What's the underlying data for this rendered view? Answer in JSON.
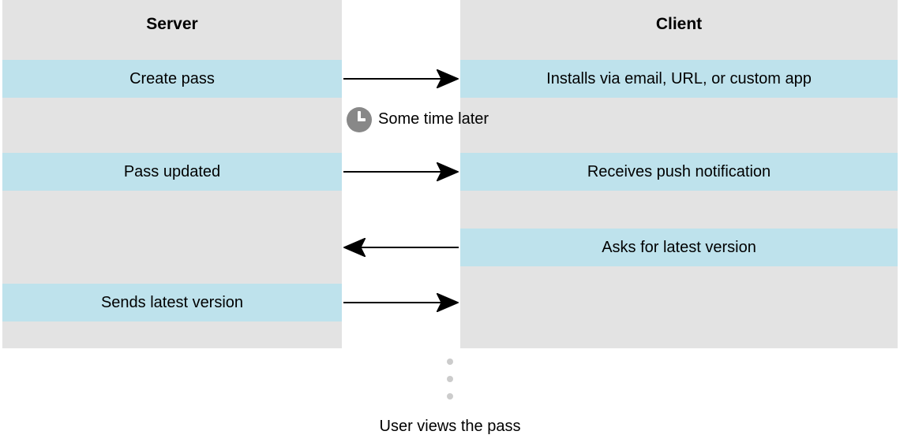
{
  "headers": {
    "server": "Server",
    "client": "Client"
  },
  "server_rows": {
    "r1": "Create pass",
    "r2": "Pass updated",
    "r4": "Sends latest version"
  },
  "client_rows": {
    "r1": "Installs via email, URL, or custom app",
    "r2": "Receives push notification",
    "r3": "Asks for latest version"
  },
  "time_label": "Some time later",
  "footer": "User views the pass"
}
